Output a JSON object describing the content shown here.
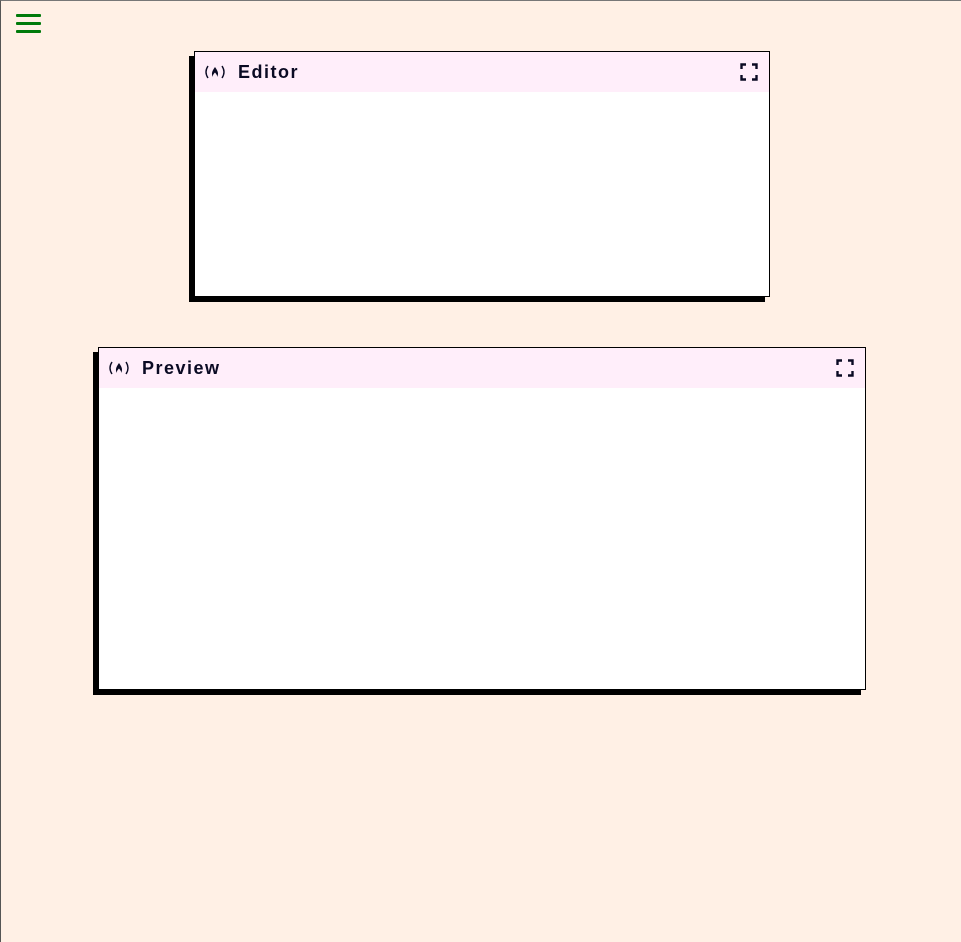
{
  "menu": {
    "icon": "hamburger-menu-icon",
    "color": "#007a0a"
  },
  "editor_panel": {
    "title": "Editor",
    "logo_icon": "freecodecamp-logo-icon",
    "maximize_icon": "maximize-icon",
    "header_color": "#ffeefa"
  },
  "preview_panel": {
    "title": "Preview",
    "logo_icon": "freecodecamp-logo-icon",
    "maximize_icon": "maximize-icon",
    "header_color": "#ffeefa"
  },
  "colors": {
    "background": "#fff0e5",
    "panel_body": "#ffffff",
    "shadow": "#000000"
  }
}
